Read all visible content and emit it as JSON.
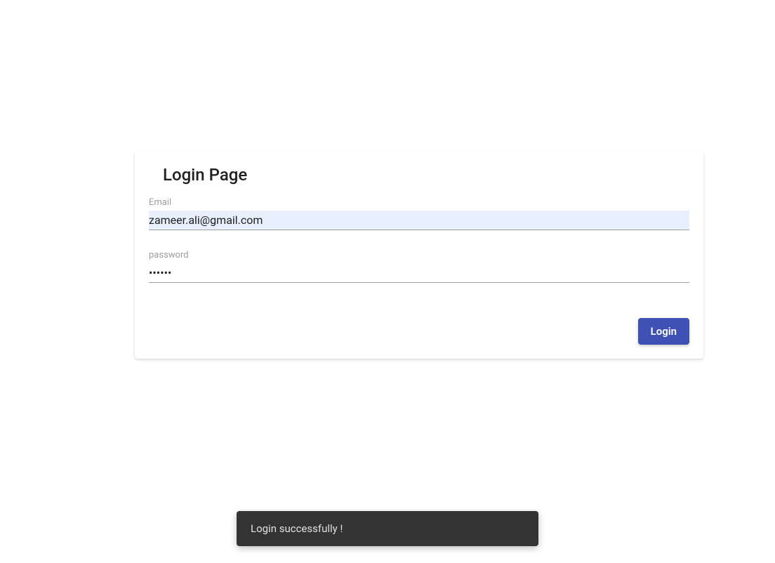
{
  "card": {
    "title": "Login Page",
    "email": {
      "label": "Email",
      "value": "zameer.ali@gmail.com"
    },
    "password": {
      "label": "password",
      "value": "••••••"
    },
    "login_button_label": "Login"
  },
  "snackbar": {
    "message": "Login successfully !"
  }
}
